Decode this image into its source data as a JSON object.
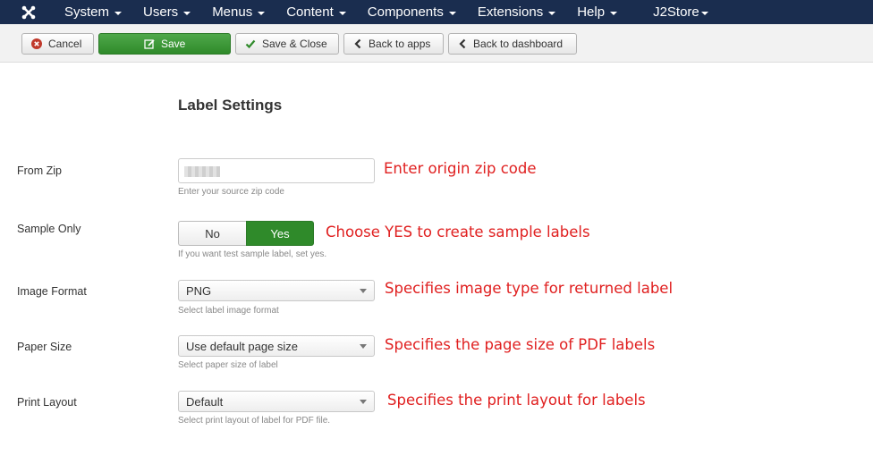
{
  "nav": {
    "logo_icon": "joomla-logo-icon",
    "items": [
      {
        "label": "System"
      },
      {
        "label": "Users"
      },
      {
        "label": "Menus"
      },
      {
        "label": "Content"
      },
      {
        "label": "Components"
      },
      {
        "label": "Extensions"
      },
      {
        "label": "Help"
      }
    ],
    "j2store": "J2Store"
  },
  "toolbar": {
    "cancel": "Cancel",
    "save": "Save",
    "save_close": "Save & Close",
    "back_apps": "Back to apps",
    "back_dashboard": "Back to dashboard"
  },
  "form": {
    "heading": "Label Settings",
    "from_zip": {
      "label": "From Zip",
      "help": "Enter your source zip code",
      "annotation": "Enter origin zip code"
    },
    "sample_only": {
      "label": "Sample Only",
      "no": "No",
      "yes": "Yes",
      "selected": "Yes",
      "help": "If you want test sample label, set yes.",
      "annotation": "Choose YES to create sample labels"
    },
    "image_format": {
      "label": "Image Format",
      "value": "PNG",
      "help": "Select label image format",
      "annotation": "Specifies image type for returned label"
    },
    "paper_size": {
      "label": "Paper Size",
      "value": "Use default page size",
      "help": "Select paper size of label",
      "annotation": "Specifies the page size of PDF labels"
    },
    "print_layout": {
      "label": "Print Layout",
      "value": "Default",
      "help": "Select print layout of label for PDF file.",
      "annotation": "Specifies the print layout for labels"
    }
  },
  "colors": {
    "navbar": "#1a2d4f",
    "save_green": "#2f8a2a",
    "annotation_red": "#e02020"
  }
}
